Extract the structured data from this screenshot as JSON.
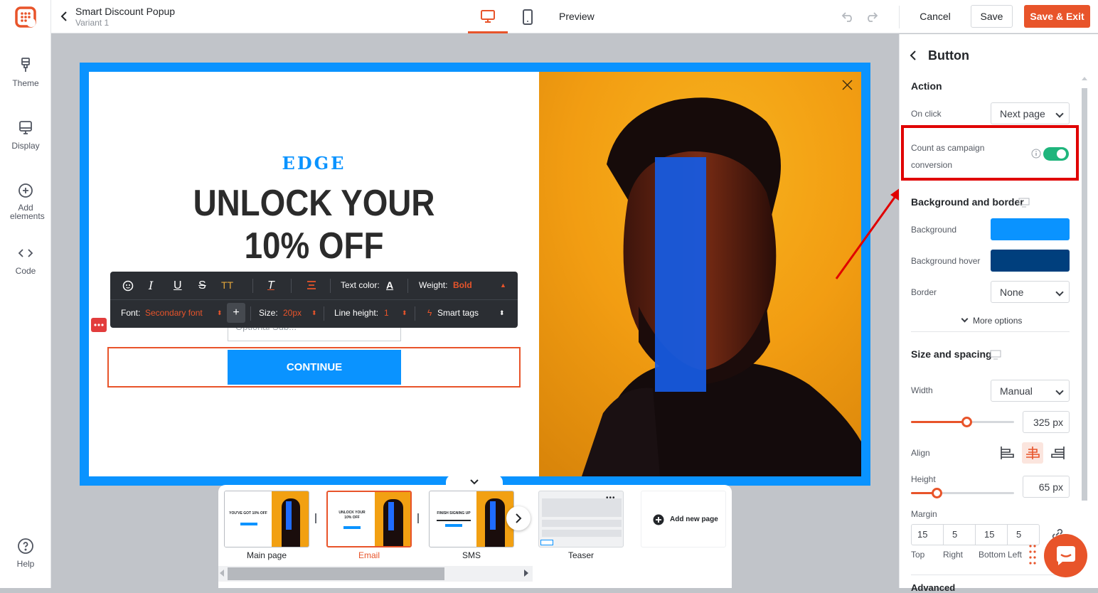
{
  "header": {
    "title": "Smart Discount Popup",
    "subtitle": "Variant 1",
    "preview_label": "Preview",
    "cancel_label": "Cancel",
    "save_label": "Save",
    "save_exit_label": "Save & Exit"
  },
  "sidebar": {
    "items": [
      {
        "label": "Theme",
        "icon": "brush-icon"
      },
      {
        "label": "Display",
        "icon": "monitor-icon"
      },
      {
        "label": "Add elements",
        "icon": "plus-circle-icon"
      },
      {
        "label": "Code",
        "icon": "code-icon"
      }
    ],
    "help_label": "Help"
  },
  "popup": {
    "brand": "EDGE",
    "headline_line1": "UNLOCK YOUR",
    "headline_line2": "10% OFF",
    "input_placeholder": "Optional Sub...",
    "button_label": "CONTINUE"
  },
  "toolbar": {
    "text_color_label": "Text color:",
    "weight_label": "Weight:",
    "weight_value": "Bold",
    "font_label": "Font:",
    "font_value": "Secondary font",
    "size_label": "Size:",
    "size_value": "20px",
    "line_height_label": "Line height:",
    "line_height_value": "1",
    "smart_tags_label": "Smart tags"
  },
  "pages": {
    "items": [
      {
        "label": "Main page",
        "active": false,
        "thumb_line1": "YOU'VE GOT 10% OFF"
      },
      {
        "label": "Email",
        "active": true,
        "thumb_line1": "UNLOCK YOUR",
        "thumb_line2": "10% OFF"
      },
      {
        "label": "SMS",
        "active": false,
        "thumb_line1": "FINISH SIGNING UP"
      },
      {
        "label": "Teaser",
        "active": false
      }
    ],
    "add_label": "Add new page"
  },
  "panel": {
    "title": "Button",
    "action_heading": "Action",
    "on_click_label": "On click",
    "on_click_value": "Next page",
    "conversion_label_line1": "Count as campaign",
    "conversion_label_line2": "conversion",
    "conversion_on": true,
    "bg_border_heading": "Background and border",
    "background_label": "Background",
    "background_color": "#0a93ff",
    "background_hover_label": "Background hover",
    "background_hover_color": "#003f7d",
    "border_label": "Border",
    "border_value": "None",
    "more_options_label": "More options",
    "size_spacing_heading": "Size and spacing",
    "width_label": "Width",
    "width_mode": "Manual",
    "width_value": "325 px",
    "width_fraction": 0.54,
    "align_label": "Align",
    "height_label": "Height",
    "height_value": "65 px",
    "height_fraction": 0.25,
    "margin_label": "Margin",
    "margin_top": "15",
    "margin_right": "5",
    "margin_bottom": "15",
    "margin_left": "5",
    "margin_top_label": "Top",
    "margin_right_label": "Right",
    "margin_bottom_label": "Bottom",
    "margin_left_label": "Left",
    "advanced_label": "Advanced"
  },
  "colors": {
    "accent": "#e8542a",
    "brand_blue": "#0a93ff",
    "toggle_green": "#1fb57c",
    "highlight_red": "#e00000"
  }
}
